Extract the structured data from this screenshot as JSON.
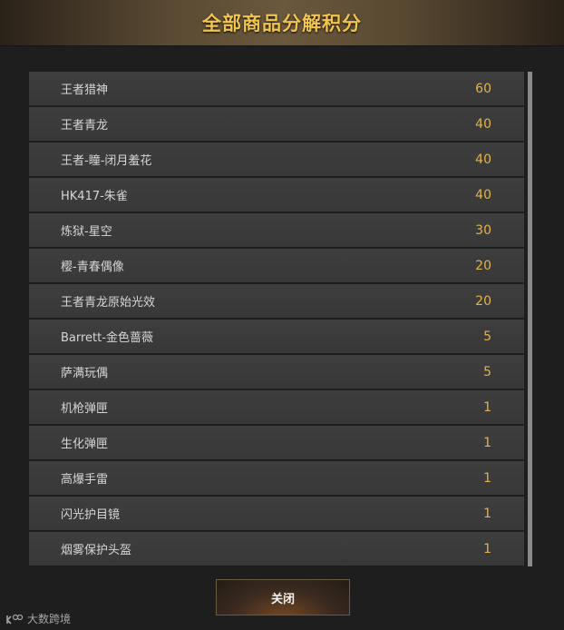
{
  "header": {
    "title": "全部商品分解积分"
  },
  "items": [
    {
      "name": "王者猎神",
      "value": "60"
    },
    {
      "name": "王者青龙",
      "value": "40"
    },
    {
      "name": "王者-瞳-闭月羞花",
      "value": "40"
    },
    {
      "name": "HK417-朱雀",
      "value": "40"
    },
    {
      "name": "炼狱-星空",
      "value": "30"
    },
    {
      "name": "樱-青春偶像",
      "value": "20"
    },
    {
      "name": "王者青龙原始光效",
      "value": "20"
    },
    {
      "name": "Barrett-金色蔷薇",
      "value": "5"
    },
    {
      "name": "萨满玩偶",
      "value": "5"
    },
    {
      "name": "机枪弹匣",
      "value": "1"
    },
    {
      "name": "生化弹匣",
      "value": "1"
    },
    {
      "name": "高爆手雷",
      "value": "1"
    },
    {
      "name": "闪光护目镜",
      "value": "1"
    },
    {
      "name": "烟雾保护头盔",
      "value": "1"
    }
  ],
  "close_button": {
    "label": "关闭"
  },
  "watermark": {
    "text": "大数跨境",
    "logo_icon": "watermark-logo-icon"
  },
  "colors": {
    "accent": "#f2c54f",
    "value": "#e3b44c",
    "row_bg": "#3b3b3b"
  }
}
